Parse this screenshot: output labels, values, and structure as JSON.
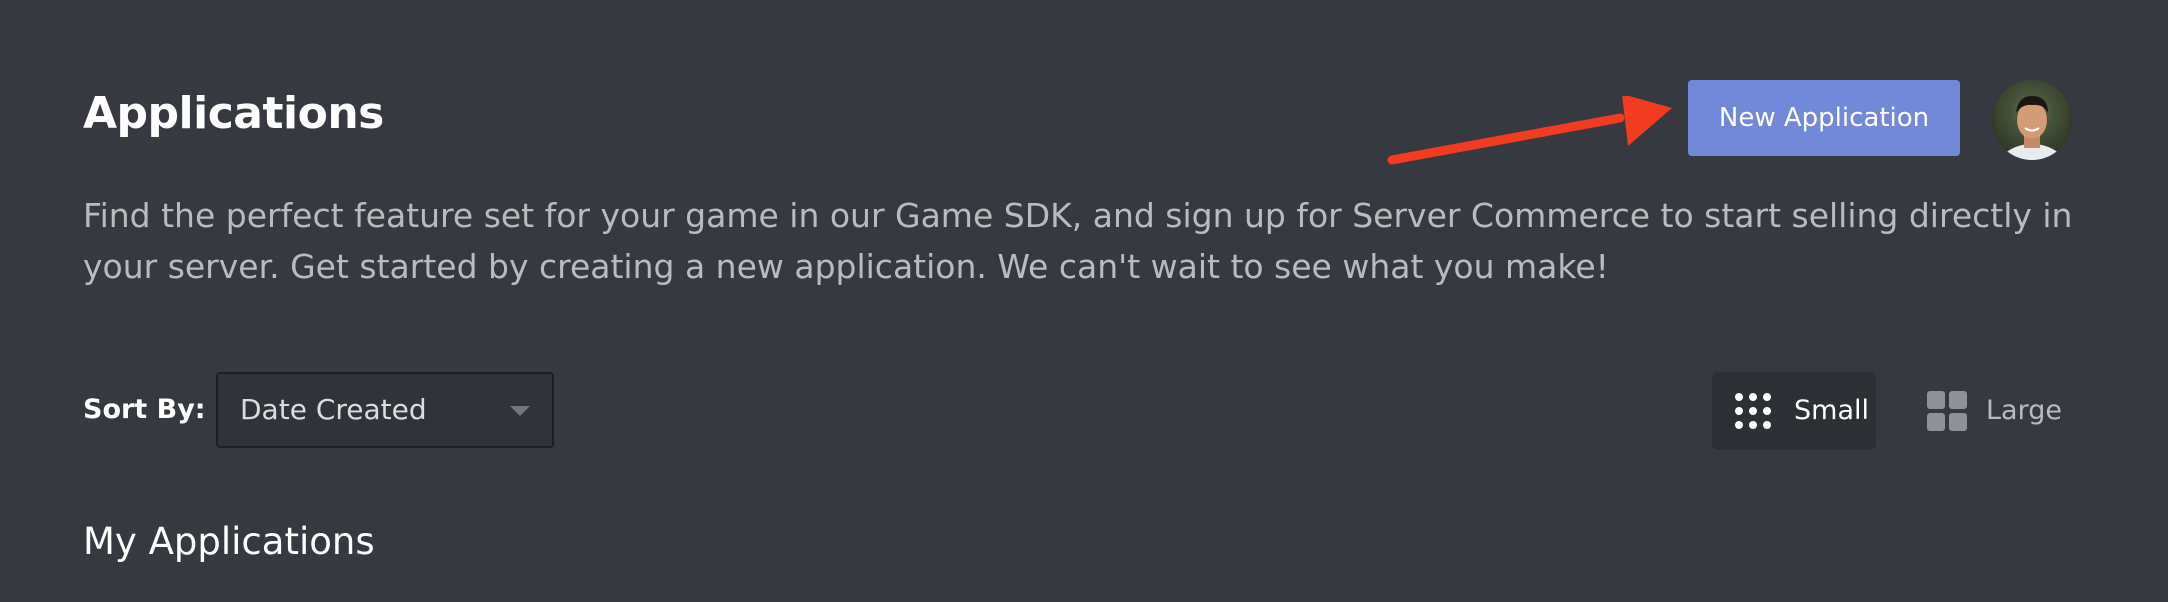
{
  "header": {
    "title": "Applications",
    "new_application_label": "New Application"
  },
  "description": "Find the perfect feature set for your game in our Game SDK, and sign up for Server Commerce to start selling directly in your server. Get started by creating a new application. We can't wait to see what you make!",
  "sort": {
    "label": "Sort By:",
    "selected": "Date Created"
  },
  "view_toggle": {
    "small_label": "Small",
    "large_label": "Large",
    "active": "Small"
  },
  "section": {
    "title": "My Applications"
  },
  "colors": {
    "background": "#36393f",
    "accent": "#7289da",
    "annotation_arrow": "#f23c22"
  },
  "icons": {
    "small_view": "dots-grid-icon",
    "large_view": "squares-grid-icon",
    "sort_dropdown": "chevron-down-icon"
  }
}
